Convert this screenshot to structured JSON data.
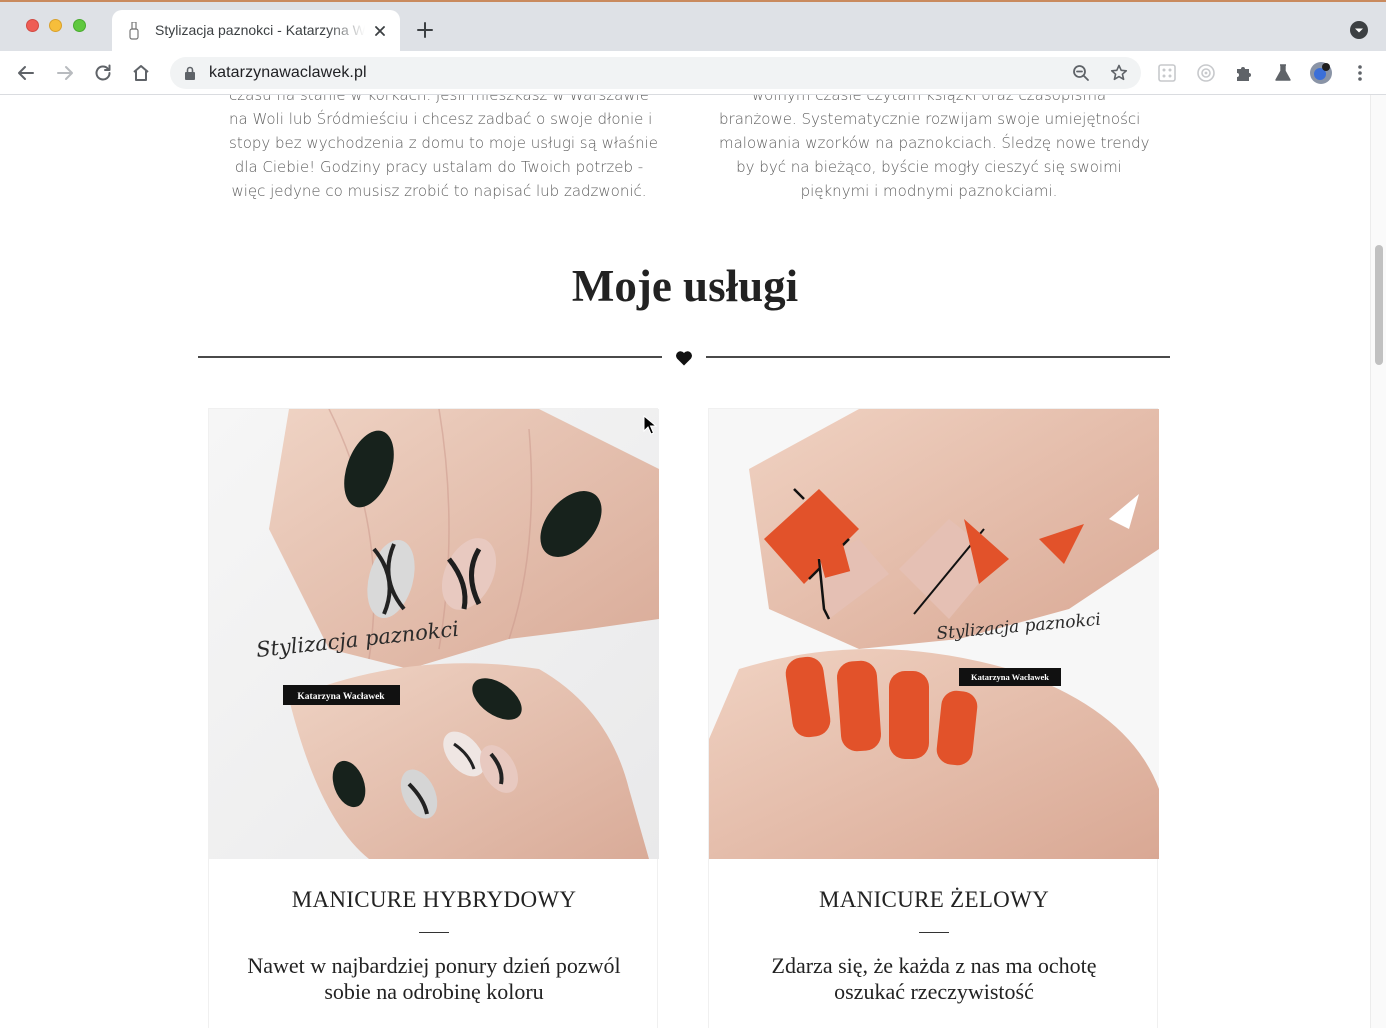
{
  "browser": {
    "tab_title": "Stylizacja paznokci - Katarzyna Wacławek",
    "url": "katarzynawaclawek.pl"
  },
  "intro": {
    "left_lines": [
      "czasu na stanie w korkach. Jeśli mieszkasz w Warszawie",
      "na Woli lub Śródmieściu i chcesz zadbać o swoje dłonie i",
      "stopy bez wychodzenia z domu to moje usługi są właśnie",
      "dla Ciebie! Godziny pracy ustalam do Twoich potrzeb -",
      "więc jedyne co musisz zrobić to napisać lub zadzwonić."
    ],
    "right_lines": [
      "wolnym czasie czytam książki oraz czasopisma",
      "branżowe. Systematycznie rozwijam swoje umiejętności",
      "malowania wzorków na paznokciach. Śledzę nowe trendy",
      "by być na bieżąco, byście mogły cieszyć się swoimi",
      "pięknymi i modnymi paznokciami."
    ]
  },
  "services": {
    "title": "Moje usługi",
    "cards": [
      {
        "title": "MANICURE HYBRYDOWY",
        "description": "Nawet w najbardziej ponury dzień pozwól sobie na odrobinę koloru",
        "image_script": "Stylizacja paznokci",
        "image_badge": "Katarzyna Wacławek"
      },
      {
        "title": "MANICURE ŻELOWY",
        "description": "Zdarza się, że każda z nas ma ochotę oszukać rzeczywistość",
        "image_script": "Stylizacja paznokci",
        "image_badge": "Katarzyna Wacławek"
      }
    ]
  },
  "colors": {
    "text_dark": "#222222",
    "text_body": "#5f5f5f",
    "nail_orange": "#e2522a",
    "nail_black": "#1d2620",
    "skin": "#e7c3b1"
  }
}
